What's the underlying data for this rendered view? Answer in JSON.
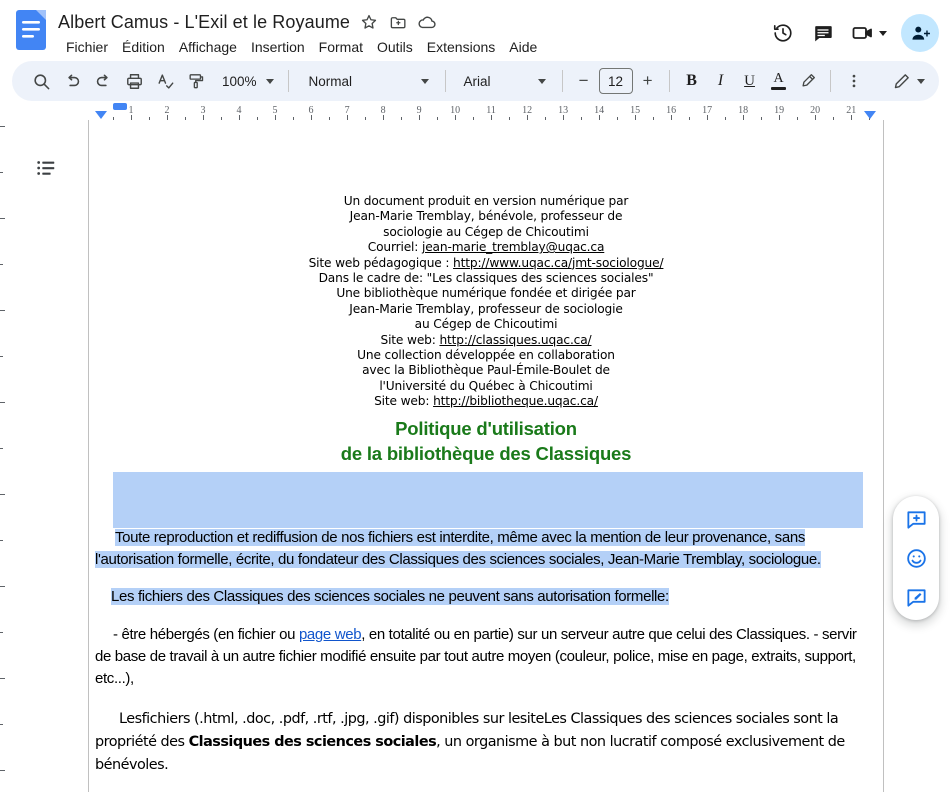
{
  "header": {
    "doc_title": "Albert Camus - L'Exil et le Royaume",
    "logo_icon": "google-docs-icon",
    "star_icon": "star-outline-icon",
    "move_icon": "move-to-folder-icon",
    "cloud_icon": "cloud-saved-icon",
    "menu": [
      {
        "label": "Fichier",
        "name": "menu-fichier"
      },
      {
        "label": "Édition",
        "name": "menu-edition"
      },
      {
        "label": "Affichage",
        "name": "menu-affichage"
      },
      {
        "label": "Insertion",
        "name": "menu-insertion"
      },
      {
        "label": "Format",
        "name": "menu-format"
      },
      {
        "label": "Outils",
        "name": "menu-outils"
      },
      {
        "label": "Extensions",
        "name": "menu-extensions"
      },
      {
        "label": "Aide",
        "name": "menu-aide"
      }
    ],
    "history_icon": "version-history-icon",
    "comments_icon": "comment-history-icon",
    "meet_icon": "video-camera-icon",
    "share_icon": "share-person-add-icon"
  },
  "toolbar": {
    "search_icon": "search-icon",
    "undo_icon": "undo-icon",
    "redo_icon": "redo-icon",
    "print_icon": "print-icon",
    "spellcheck_icon": "spellcheck-icon",
    "paint_format_icon": "paint-format-icon",
    "zoom_value": "100%",
    "style_value": "Normal",
    "font_value": "Arial",
    "font_size_value": "12",
    "decrease_label": "−",
    "increase_label": "+",
    "bold_label": "B",
    "italic_label": "I",
    "underline_label": "U",
    "text_color_label": "A",
    "highlight_icon": "highlight-pen-icon",
    "more_icon": "more-options-vertical-dots-icon",
    "editing_mode_icon": "editing-pencil-icon"
  },
  "ruler": {
    "unit_labels": [
      "1",
      "2",
      "3",
      "4",
      "5",
      "6",
      "7",
      "8",
      "9",
      "10",
      "11",
      "12",
      "13",
      "14",
      "15",
      "16",
      "17",
      "18",
      "19",
      "20",
      "21"
    ],
    "left_indent_marker": "left-indent-marker",
    "first_line_marker": "first-line-indent-marker",
    "right_indent_marker": "right-indent-marker"
  },
  "sidebar": {
    "outline_icon": "document-outline-icon"
  },
  "document": {
    "cover_block_1": [
      "Un document produit en version numérique par",
      "Jean-Marie Tremblay, bénévole, professeur de",
      "sociologie au Cégep de Chicoutimi"
    ],
    "courriel_label": "Courriel: ",
    "courriel_link": "jean-marie_tremblay@uqac.ca",
    "siteweb_peda_label": "Site web pédagogique : ",
    "siteweb_peda_link": "http://www.uqac.ca/jmt-sociologue/",
    "cover_block_2": [
      "Dans le cadre de: \"Les classiques des sciences sociales\"",
      "Une bibliothèque numérique fondée et dirigée par",
      "Jean-Marie Tremblay, professeur de sociologie",
      "au Cégep de Chicoutimi"
    ],
    "siteweb_2_label": "Site web: ",
    "siteweb_2_link": "http://classiques.uqac.ca/",
    "cover_block_3": [
      "Une collection développée en collaboration",
      "avec la Bibliothèque Paul-Émile-Boulet de",
      "l'Université du Québec à Chicoutimi"
    ],
    "siteweb_3_label": "Site web: ",
    "siteweb_3_link": "http://bibliotheque.uqac.ca/",
    "heading_line1": "Politique d'utilisation",
    "heading_line2": "de la bibliothèque des Classiques",
    "para_1_a": "Toute reproduction et rediffusion de nos fichiers est interdite, même avec la mention de leur provenance, sans l'autorisation formelle, écrite, du fondateur des Classiques des sciences sociales, Jean-Marie Tremblay, sociologue.",
    "para_2": "Les fichiers des Classiques des sciences sociales ne peuvent sans autorisation formelle:",
    "para_3_pre": "- être hébergés (en fichier ou ",
    "para_3_link": "page web",
    "para_3_post": ", en totalité ou en partie) sur un serveur autre que celui des Classiques. - servir de base de travail à un autre fichier modifié ensuite par tout autre moyen (couleur, police, mise en page, extraits, support, etc...),",
    "para_4_pre": "Lesfichiers (.html, .doc, .pdf, .rtf, .jpg, .gif) disponibles sur lesiteLes Classiques des sciences sociales sont la propriété des ",
    "para_4_bold": "Classiques des sciences sociales",
    "para_4_post": ", un organisme à but non lucratif composé exclusivement de bénévoles."
  },
  "float_bar": {
    "add_comment_icon": "add-comment-icon",
    "emoji_reaction_icon": "emoji-reaction-icon",
    "suggest_edit_icon": "suggest-edit-icon"
  },
  "colors": {
    "accent_blue": "#1a73e8",
    "toolbar_bg": "#edf2fa",
    "share_bg": "#c2e7ff",
    "selection": "#b4d0f7",
    "heading_green": "#1a7a1a",
    "link_blue": "#1155cc"
  }
}
